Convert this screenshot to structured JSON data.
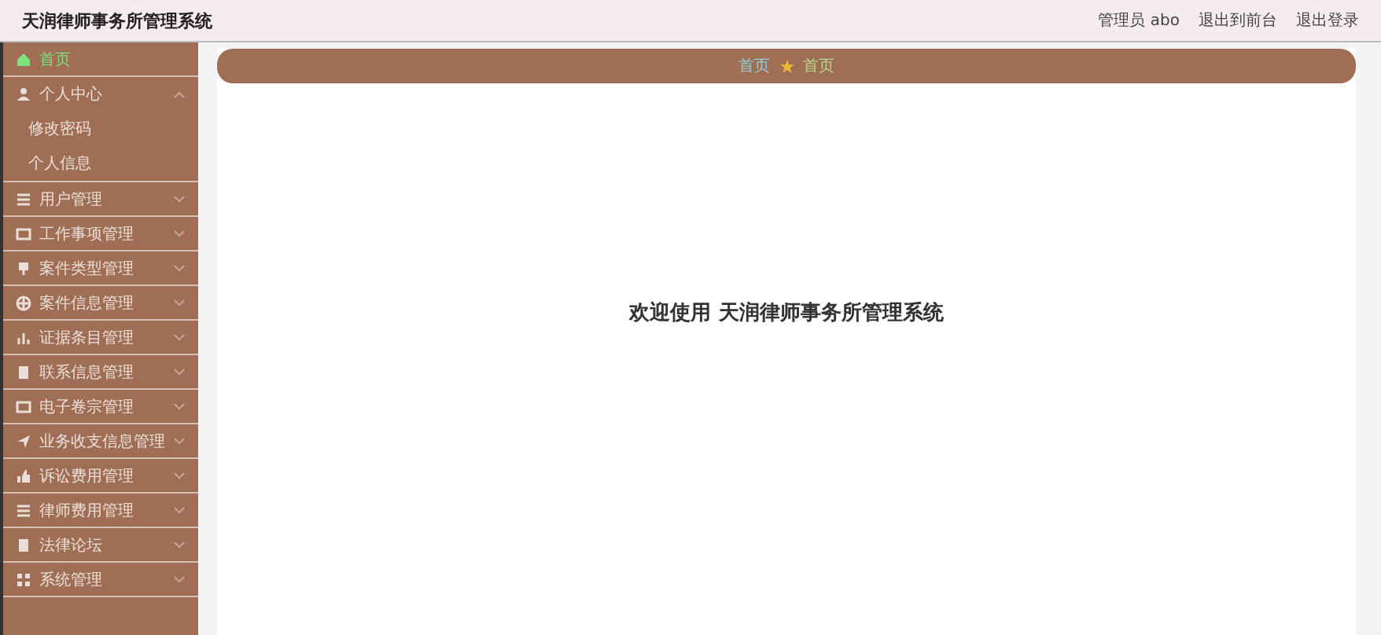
{
  "header": {
    "title": "天润律师事务所管理系统",
    "user": "管理员 abo",
    "links": [
      "退出到前台",
      "退出登录"
    ]
  },
  "sidebar": {
    "items": [
      {
        "label": "首页",
        "selected": true
      },
      {
        "label": "个人中心",
        "selected": false,
        "expanded": true,
        "children": [
          {
            "label": "修改密码",
            "selected": false
          },
          {
            "label": "个人信息",
            "selected": false
          }
        ]
      },
      {
        "label": "用户管理",
        "selected": false,
        "expanded": false
      },
      {
        "label": "工作事项管理",
        "selected": false,
        "expanded": false
      },
      {
        "label": "案件类型管理",
        "selected": false,
        "expanded": false
      },
      {
        "label": "案件信息管理",
        "selected": false,
        "expanded": false
      },
      {
        "label": "证据条目管理",
        "selected": false,
        "expanded": false
      },
      {
        "label": "联系信息管理",
        "selected": false,
        "expanded": false
      },
      {
        "label": "电子卷宗管理",
        "selected": false,
        "expanded": false
      },
      {
        "label": "业务收支信息管理",
        "selected": false,
        "expanded": false
      },
      {
        "label": "诉讼费用管理",
        "selected": false,
        "expanded": false
      },
      {
        "label": "律师费用管理",
        "selected": false,
        "expanded": false
      },
      {
        "label": "法律论坛",
        "selected": false,
        "expanded": false
      },
      {
        "label": "系统管理",
        "selected": false,
        "expanded": false
      }
    ]
  },
  "breadcrumb": [
    "首页",
    "首页"
  ],
  "welcome": "欢迎使用 天润律师事务所管理系统"
}
